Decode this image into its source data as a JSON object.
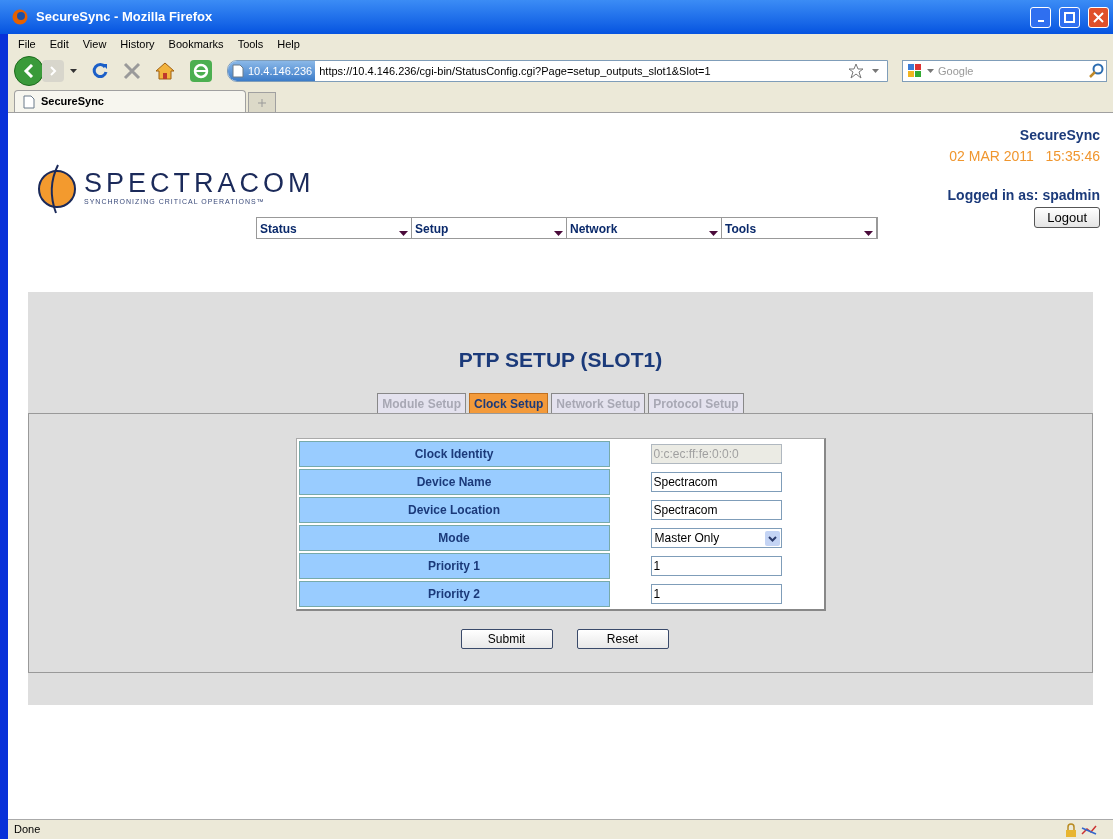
{
  "window": {
    "title": "SecureSync - Mozilla Firefox"
  },
  "menu": [
    "File",
    "Edit",
    "View",
    "History",
    "Bookmarks",
    "Tools",
    "Help"
  ],
  "address_bar": {
    "site": "10.4.146.236",
    "url": "https://10.4.146.236/cgi-bin/StatusConfig.cgi?Page=setup_outputs_slot1&Slot=1"
  },
  "search": {
    "placeholder": "Google"
  },
  "browser_tabs": [
    {
      "label": "SecureSync",
      "selected": true
    }
  ],
  "header": {
    "logo": "SPECTRACOM",
    "tagline": "SYNCHRONIZING CRITICAL OPERATIONS™",
    "product": "SecureSync",
    "datetime": "02 MAR 2011   15:35:46",
    "login": "Logged in as: spadmin",
    "logout": "Logout"
  },
  "nav": [
    "Status",
    "Setup",
    "Network",
    "Tools"
  ],
  "page_title": "PTP SETUP (SLOT1)",
  "tabs": [
    {
      "label": "Module Setup",
      "selected": false
    },
    {
      "label": "Clock Setup",
      "selected": true
    },
    {
      "label": "Network Setup",
      "selected": false
    },
    {
      "label": "Protocol Setup",
      "selected": false
    }
  ],
  "form": [
    {
      "label": "Clock Identity",
      "kind": "text",
      "value": "0:c:ec:ff:fe:0:0:0",
      "disabled": true
    },
    {
      "label": "Device Name",
      "kind": "text",
      "value": "Spectracom",
      "disabled": false
    },
    {
      "label": "Device Location",
      "kind": "text",
      "value": "Spectracom",
      "disabled": false
    },
    {
      "label": "Mode",
      "kind": "select",
      "value": "Master Only",
      "disabled": false
    },
    {
      "label": "Priority 1",
      "kind": "text",
      "value": "1",
      "disabled": false
    },
    {
      "label": "Priority 2",
      "kind": "text",
      "value": "1",
      "disabled": false
    }
  ],
  "buttons": [
    "Submit",
    "Reset"
  ],
  "status_bar": "Done"
}
